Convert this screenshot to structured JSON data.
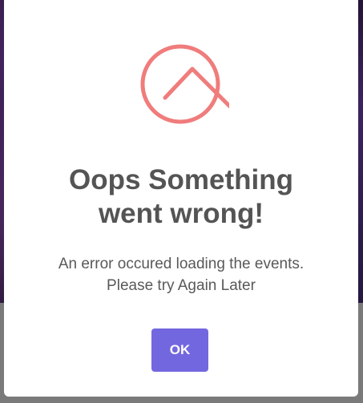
{
  "dialog": {
    "title_line1": "Oops Something",
    "title_line2": "went wrong!",
    "message_line1": "An error occured loading the events.",
    "message_line2": "Please try Again Later",
    "ok_label": "OK",
    "icon": "error-circle-icon"
  },
  "colors": {
    "icon": "#f07c7c",
    "button": "#7367e0",
    "title": "#545454",
    "text": "#595959",
    "overlay": "#7a7a7a"
  }
}
